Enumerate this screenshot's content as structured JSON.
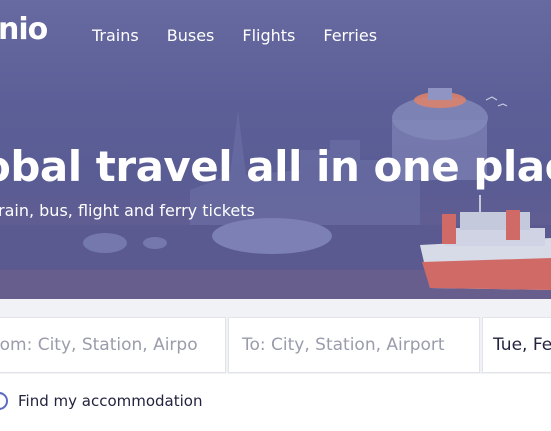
{
  "header": {
    "logo_text": "nio",
    "nav": [
      "Trains",
      "Buses",
      "Flights",
      "Ferries"
    ]
  },
  "hero": {
    "headline": "obal travel all in one plac",
    "subline": "rain, bus, flight and ferry tickets"
  },
  "search": {
    "from_placeholder": "rom: City, Station, Airpo",
    "to_placeholder": "To: City, Station, Airport",
    "date_value": "Tue, Fe"
  },
  "options": {
    "accommodation_label": "Find my accommodation"
  },
  "colors": {
    "hero_bg": "#5c5f97",
    "text_dark": "#23233f",
    "placeholder": "#9b9cab",
    "radio_accent": "#5c6bc0"
  }
}
